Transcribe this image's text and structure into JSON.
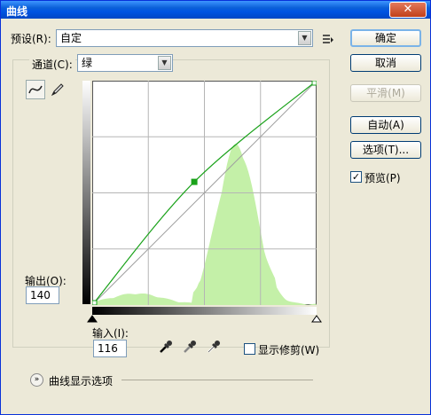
{
  "window": {
    "title": "曲线",
    "close_glyph": "✕"
  },
  "preset": {
    "label": "预设(R):",
    "value": "自定",
    "menu_icon": "preset-options-icon"
  },
  "channel": {
    "label": "通道(C):",
    "value": "绿"
  },
  "buttons": {
    "ok": "确定",
    "cancel": "取消",
    "smooth": "平滑(M)",
    "auto": "自动(A)",
    "options": "选项(T)..."
  },
  "preview": {
    "label": "预览(P)",
    "checked": true
  },
  "output": {
    "label": "输出(O):",
    "value": "140"
  },
  "input": {
    "label": "输入(I):",
    "value": "116"
  },
  "show_clipping": {
    "label": "显示修剪(W)",
    "checked": false
  },
  "curve_display_options": {
    "label": "曲线显示选项"
  },
  "colors": {
    "curve": "#1aa21a",
    "histogram": "#c4f0a8",
    "grid": "#b5b5b5",
    "accent": "#0054e3"
  },
  "curve": {
    "points": [
      [
        0,
        0
      ],
      [
        116,
        140
      ],
      [
        255,
        255
      ]
    ]
  }
}
